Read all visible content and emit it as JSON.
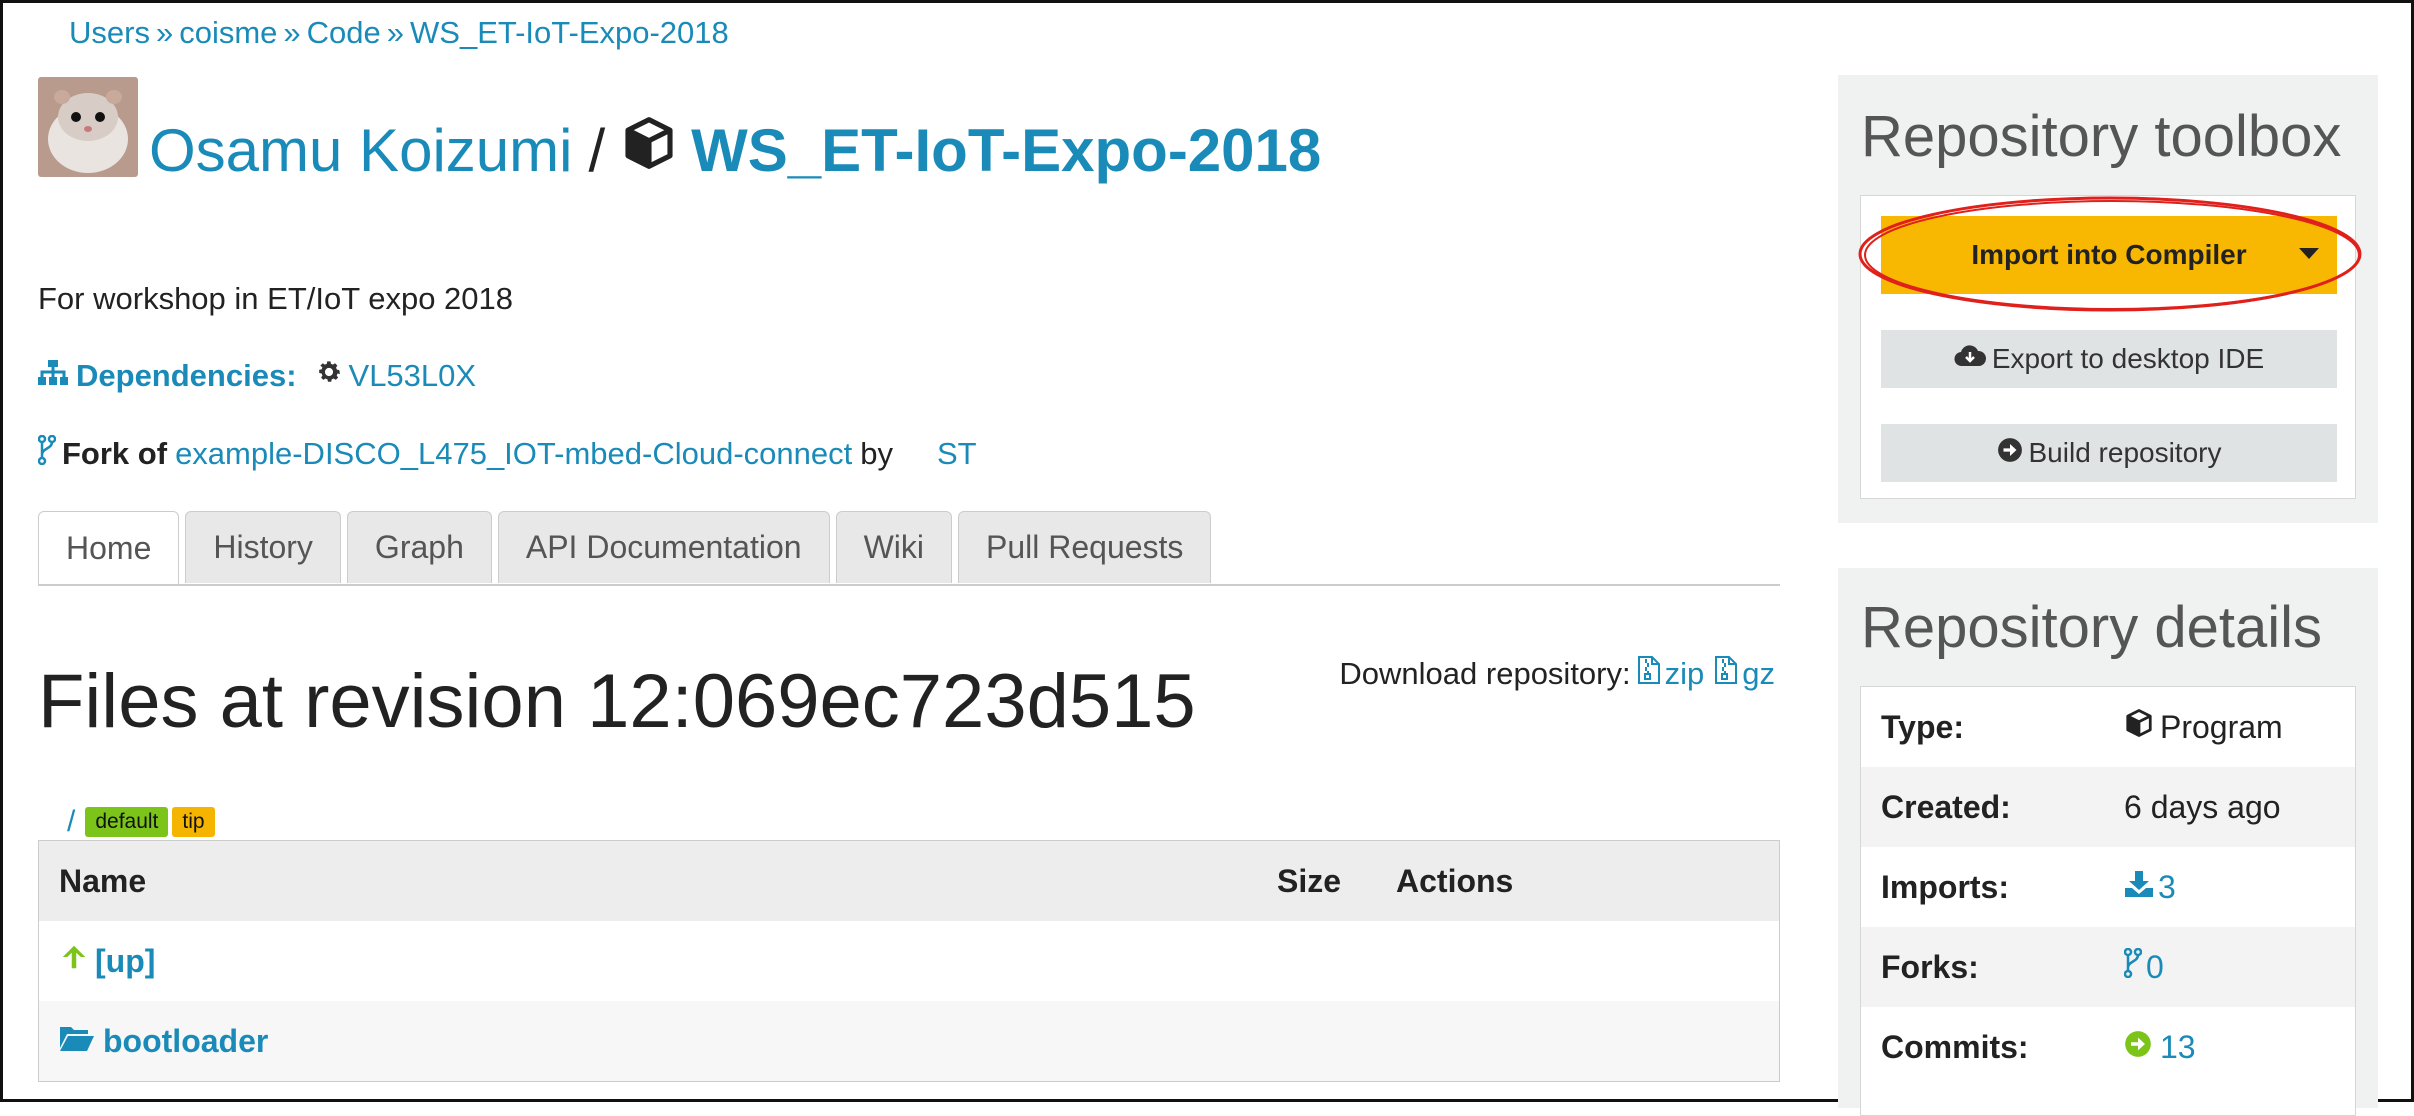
{
  "breadcrumb": {
    "items": [
      "Users",
      "coisme",
      "Code",
      "WS_ET-IoT-Expo-2018"
    ],
    "separator": "»"
  },
  "header": {
    "owner_name": "Osamu Koizumi",
    "slash": "/",
    "repo_name": "WS_ET-IoT-Expo-2018"
  },
  "description": "For workshop in ET/IoT expo 2018",
  "dependencies": {
    "label": "Dependencies:",
    "items": [
      "VL53L0X"
    ]
  },
  "fork": {
    "prefix": "Fork of",
    "source": "example-DISCO_L475_IOT-mbed-Cloud-connect",
    "by": "by",
    "author": "ST"
  },
  "tabs": [
    {
      "label": "Home",
      "active": true
    },
    {
      "label": "History"
    },
    {
      "label": "Graph"
    },
    {
      "label": "API Documentation"
    },
    {
      "label": "Wiki"
    },
    {
      "label": "Pull Requests"
    }
  ],
  "files": {
    "heading": "Files at revision 12:069ec723d515",
    "download_label": "Download repository:",
    "download_zip": "zip",
    "download_gz": "gz",
    "path": "/",
    "badges": [
      "default",
      "tip"
    ],
    "columns": [
      "Name",
      "Size",
      "Actions"
    ],
    "rows": [
      {
        "name": "[up]",
        "icon": "arrow-up-icon"
      },
      {
        "name": "bootloader",
        "icon": "folder-open-icon"
      }
    ]
  },
  "toolbox": {
    "title": "Repository toolbox",
    "import_label": "Import into Compiler",
    "export_label": "Export to desktop IDE",
    "build_label": "Build repository"
  },
  "details": {
    "title": "Repository details",
    "type_label": "Type:",
    "type_value": "Program",
    "created_label": "Created:",
    "created_value": "6 days ago",
    "imports_label": "Imports:",
    "imports_value": "3",
    "forks_label": "Forks:",
    "forks_value": "0",
    "commits_label": "Commits:",
    "commits_value": "13"
  },
  "colors": {
    "link": "#1a8bb8",
    "import_button": "#f8b700",
    "badge_default": "#7cc41a",
    "badge_tip": "#f5b400",
    "annotation": "#e0201b"
  }
}
